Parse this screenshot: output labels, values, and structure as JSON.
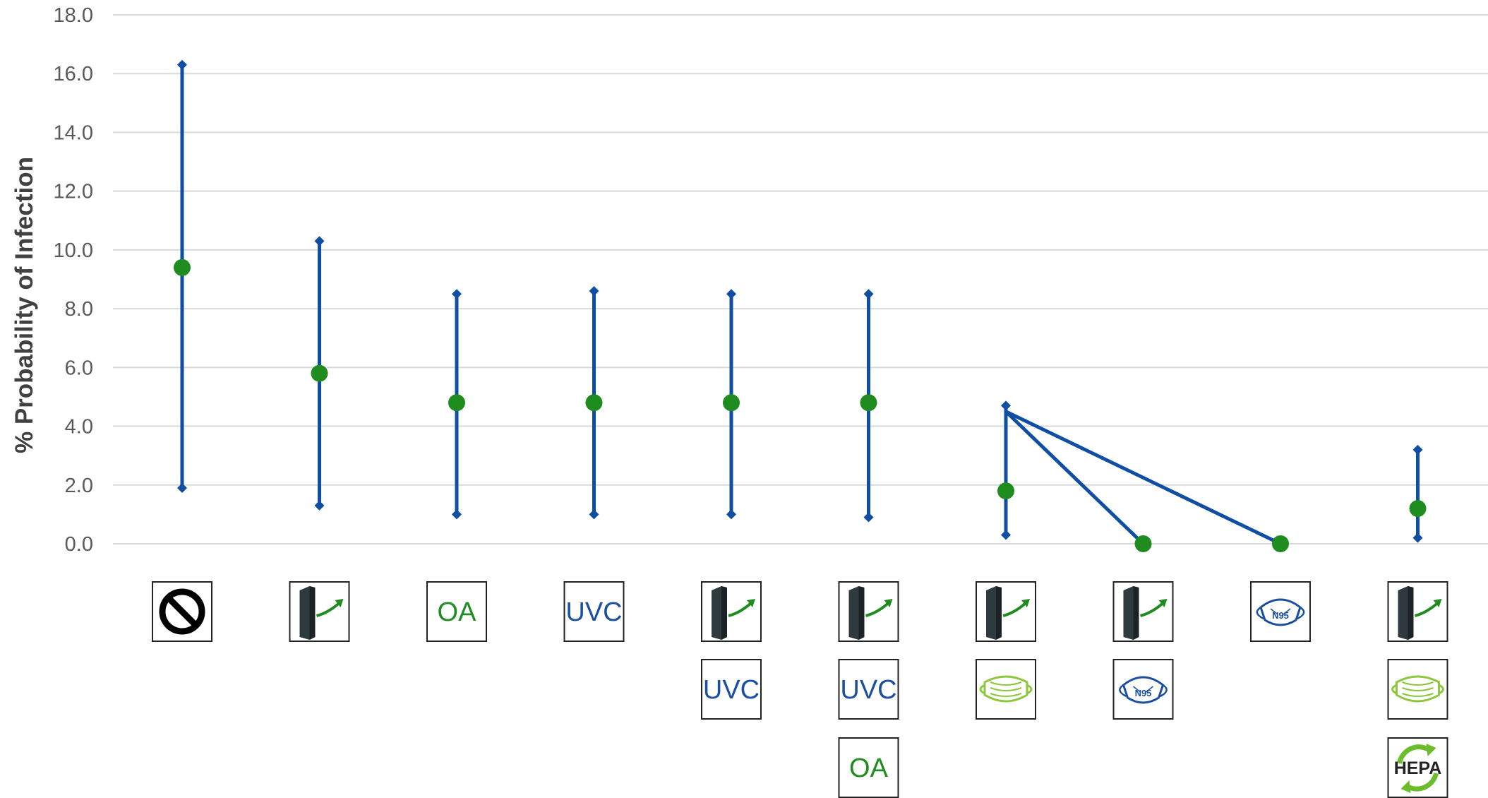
{
  "colors": {
    "accent": "#0f4ea3",
    "point": "#1e8c1e",
    "grid": "#d9d9d9",
    "uvc": "#1b4fa0",
    "oa": "#1e8c1e"
  },
  "chart_data": {
    "type": "scatter",
    "title": "",
    "xlabel": "",
    "ylabel": "% Probability of Infection",
    "ylim": [
      0,
      18
    ],
    "yticks": [
      "0.0",
      "2.0",
      "4.0",
      "6.0",
      "8.0",
      "10.0",
      "12.0",
      "14.0",
      "16.0",
      "18.0"
    ],
    "grid": true,
    "legend": "none",
    "points": [
      {
        "index": 0,
        "value": 9.4,
        "low": 1.9,
        "high": 16.3,
        "icons": [
          "no-intervention"
        ]
      },
      {
        "index": 1,
        "value": 5.8,
        "low": 1.3,
        "high": 10.3,
        "icons": [
          "filter"
        ]
      },
      {
        "index": 2,
        "value": 4.8,
        "low": 1.0,
        "high": 8.5,
        "icons": [
          "OA"
        ]
      },
      {
        "index": 3,
        "value": 4.8,
        "low": 1.0,
        "high": 8.6,
        "icons": [
          "UVC"
        ]
      },
      {
        "index": 4,
        "value": 4.8,
        "low": 1.0,
        "high": 8.5,
        "icons": [
          "filter",
          "UVC"
        ]
      },
      {
        "index": 5,
        "value": 4.8,
        "low": 0.9,
        "high": 8.5,
        "icons": [
          "filter",
          "UVC",
          "OA"
        ]
      },
      {
        "index": 6,
        "value": 1.8,
        "low": 0.3,
        "high": 4.7,
        "icons": [
          "filter",
          "surgical-mask"
        ]
      },
      {
        "index": 7,
        "value": 0.0,
        "low": 0.0,
        "high": 0.0,
        "icons": [
          "filter",
          "n95-mask"
        ]
      },
      {
        "index": 8,
        "value": 0.0,
        "low": 0.0,
        "high": 0.0,
        "icons": [
          "n95-mask"
        ]
      },
      {
        "index": 9,
        "value": 1.2,
        "low": 0.2,
        "high": 3.2,
        "icons": [
          "filter",
          "surgical-mask",
          "HEPA"
        ]
      }
    ],
    "connector_lines": [
      {
        "from_index": 6,
        "from_value": 4.5,
        "to_index": 7,
        "to_value": 0.0
      },
      {
        "from_index": 6,
        "from_value": 4.5,
        "to_index": 8,
        "to_value": 0.0
      }
    ],
    "icon_text": {
      "OA": "OA",
      "UVC": "UVC",
      "HEPA": "HEPA",
      "N95": "N95"
    }
  }
}
